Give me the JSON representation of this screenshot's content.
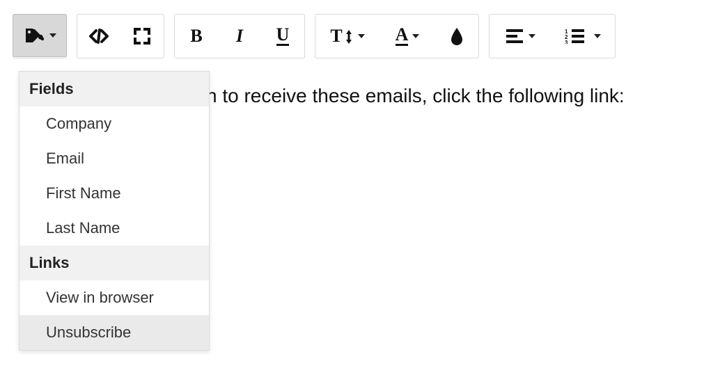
{
  "toolbar": {
    "tags_btn": "tags",
    "codeview_btn": "codeview",
    "fullscreen_btn": "fullscreen",
    "bold_label": "B",
    "italic_label": "I",
    "underline_label": "U",
    "fontsize_label": "T",
    "fontcolor_label": "A"
  },
  "dropdown": {
    "groups": [
      {
        "title": "Fields",
        "items": [
          "Company",
          "Email",
          "First Name",
          "Last Name"
        ]
      },
      {
        "title": "Links",
        "items": [
          "View in browser",
          "Unsubscribe"
        ]
      }
    ],
    "hovered": "Unsubscribe"
  },
  "editor": {
    "body_text": "sh to receive these emails, click the following link:"
  }
}
